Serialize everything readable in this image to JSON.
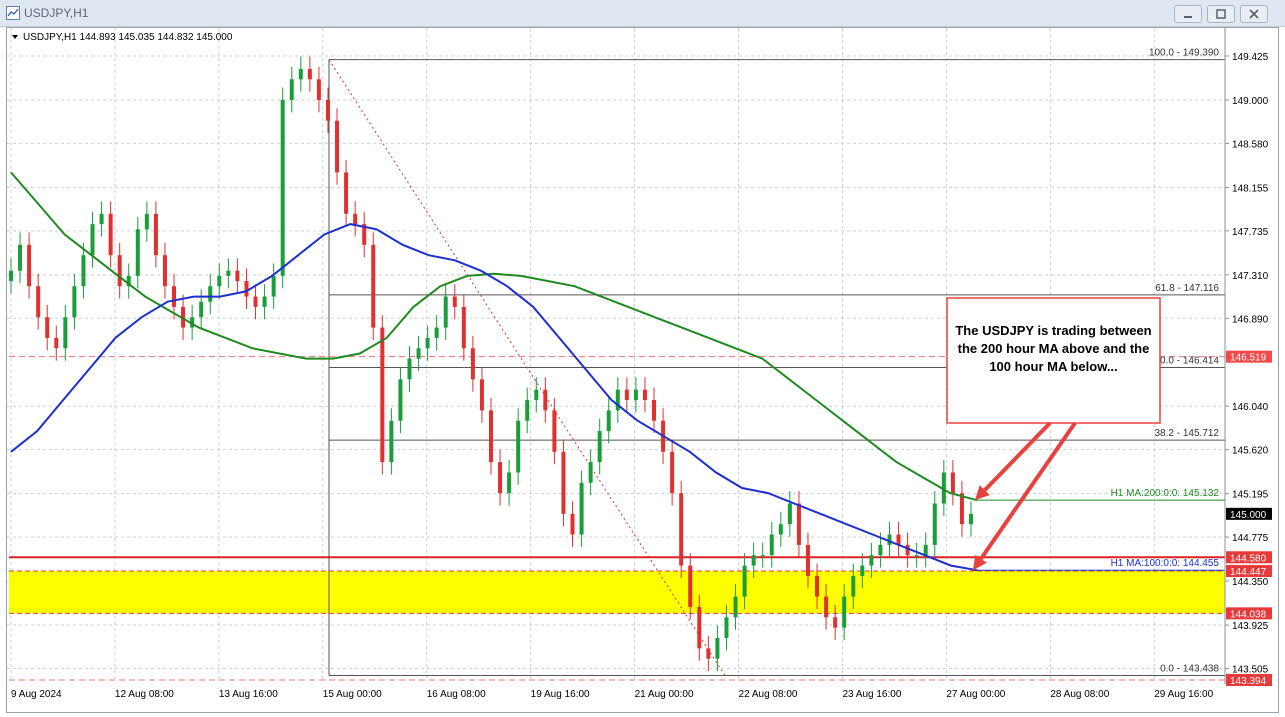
{
  "window": {
    "title": "USDJPY,H1",
    "icon": "chart-window-icon",
    "buttons": [
      "minimize-icon",
      "maximize-icon",
      "close-icon"
    ]
  },
  "chart_data": {
    "type": "line",
    "symbol_info": "USDJPY,H1  144.893 145.035 144.832 145.000",
    "yaxis": {
      "min": 143.394,
      "max": 149.425,
      "ticks": [
        "149.425",
        "149.000",
        "148.580",
        "148.155",
        "147.735",
        "147.310",
        "146.890",
        "146.040",
        "145.620",
        "145.195",
        "144.775",
        "144.350",
        "143.925",
        "143.505"
      ]
    },
    "xaxis": {
      "ticks": [
        "9 Aug 2024",
        "12 Aug 08:00",
        "13 Aug 16:00",
        "15 Aug 00:00",
        "16 Aug 08:00",
        "19 Aug 16:00",
        "21 Aug 00:00",
        "22 Aug 08:00",
        "23 Aug 16:00",
        "27 Aug 00:00",
        "28 Aug 08:00",
        "29 Aug 16:00"
      ]
    },
    "price_series": {
      "name": "USDJPY",
      "values": [
        147.35,
        147.6,
        147.2,
        146.9,
        146.7,
        146.6,
        146.9,
        147.2,
        147.5,
        147.8,
        147.9,
        147.5,
        147.2,
        147.3,
        147.75,
        147.9,
        147.5,
        147.2,
        147.0,
        146.8,
        146.9,
        147.05,
        147.2,
        147.3,
        147.35,
        147.25,
        147.1,
        147.0,
        147.1,
        147.3,
        149.0,
        149.2,
        149.3,
        149.2,
        149.0,
        148.8,
        148.3,
        147.9,
        147.8,
        147.6,
        146.8,
        145.5,
        145.9,
        146.3,
        146.5,
        146.6,
        146.7,
        146.8,
        147.1,
        147.0,
        146.6,
        146.3,
        146.0,
        145.5,
        145.2,
        145.4,
        145.9,
        146.1,
        146.2,
        146.0,
        145.6,
        145.0,
        144.8,
        145.3,
        145.5,
        145.8,
        146.0,
        146.2,
        146.1,
        146.2,
        146.1,
        145.9,
        145.6,
        145.2,
        144.5,
        144.1,
        143.7,
        143.6,
        143.8,
        144.0,
        144.2,
        144.5,
        144.6,
        144.6,
        144.8,
        144.9,
        145.1,
        144.7,
        144.4,
        144.2,
        144.0,
        143.9,
        144.2,
        144.4,
        144.5,
        144.6,
        144.7,
        144.8,
        144.7,
        144.6,
        144.6,
        144.7,
        145.1,
        145.4,
        145.2,
        144.9,
        145.0
      ]
    },
    "ma200": {
      "label": "H1 MA:200:0:0: 145.132",
      "value": 145.132,
      "values": [
        148.3,
        148.0,
        147.7,
        147.5,
        147.3,
        147.1,
        146.95,
        146.8,
        146.7,
        146.6,
        146.55,
        146.5,
        146.5,
        146.55,
        146.7,
        147.0,
        147.2,
        147.3,
        147.32,
        147.3,
        147.25,
        147.2,
        147.1,
        147.0,
        146.9,
        146.8,
        146.7,
        146.6,
        146.5,
        146.3,
        146.1,
        145.9,
        145.7,
        145.5,
        145.35,
        145.2,
        145.132
      ]
    },
    "ma100": {
      "label": "H1 MA:100:0:0: 144.455",
      "value": 144.455,
      "values": [
        145.6,
        145.8,
        146.1,
        146.4,
        146.7,
        146.9,
        147.05,
        147.1,
        147.1,
        147.15,
        147.3,
        147.5,
        147.7,
        147.8,
        147.75,
        147.6,
        147.5,
        147.45,
        147.35,
        147.2,
        147.0,
        146.7,
        146.4,
        146.1,
        145.9,
        145.75,
        145.6,
        145.4,
        145.25,
        145.2,
        145.1,
        145.0,
        144.9,
        144.8,
        144.7,
        144.6,
        144.5,
        144.455
      ]
    },
    "fibonacci": [
      {
        "label": "100.0 - 149.390",
        "value": 149.39
      },
      {
        "label": "61.8 - 147.116",
        "value": 147.116
      },
      {
        "label": "50.0 - 146.414",
        "value": 146.414
      },
      {
        "label": "38.2 - 145.712",
        "value": 145.712
      },
      {
        "label": "0.0 - 143.438",
        "value": 143.438
      }
    ],
    "price_tags": [
      {
        "label": "146.519",
        "value": 146.519,
        "color": "#f04a4a"
      },
      {
        "label": "145.000",
        "value": 145.0,
        "color": "#000000"
      },
      {
        "label": "144.580",
        "value": 144.58,
        "color": "#e83a3a"
      },
      {
        "label": "144.447",
        "value": 144.447,
        "color": "#e83a3a"
      },
      {
        "label": "144.038",
        "value": 144.038,
        "color": "#e83a3a"
      },
      {
        "label": "143.394",
        "value": 143.394,
        "color": "#e83a3a"
      }
    ],
    "support_zone": {
      "from": 144.038,
      "to": 144.447,
      "color": "#ffff00"
    },
    "red_line": 144.58,
    "annotation": "The USDJPY is trading between the 200 hour MA above and the 100 hour MA below...",
    "colors": {
      "up": "#1a9e3a",
      "down": "#e03030",
      "ma200": "#1f8a1f",
      "ma100": "#1c2fd0",
      "grid": "#c9d0d6",
      "accent": "#e8423f"
    },
    "grid": true
  }
}
